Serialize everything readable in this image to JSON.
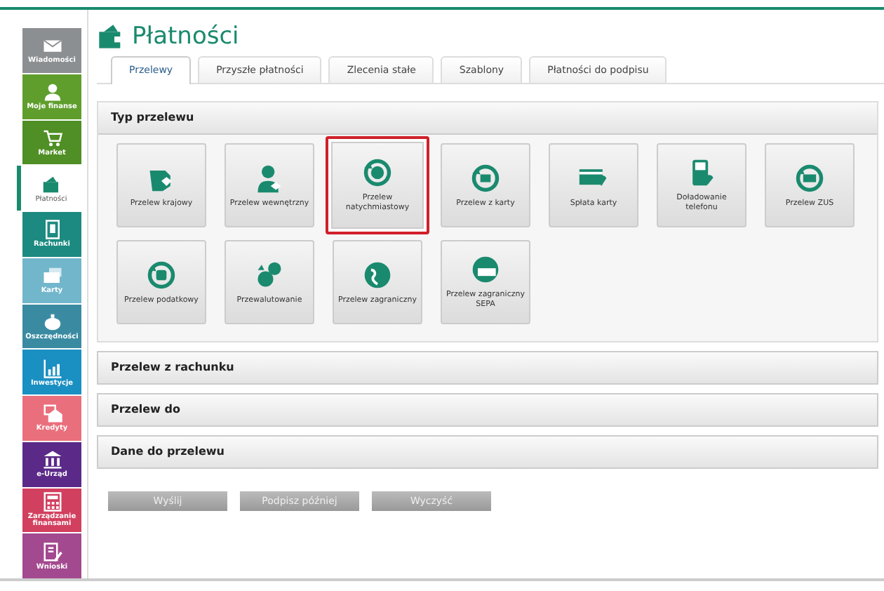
{
  "sidebar": {
    "items": [
      {
        "label": "Wiadomości",
        "selected": false,
        "color": "#8c8f92"
      },
      {
        "label": "Moje finanse",
        "selected": false,
        "color": "#5f9e2c"
      },
      {
        "label": "Market",
        "selected": false,
        "color": "#4f8f25"
      },
      {
        "label": "Płatności",
        "selected": true,
        "color": "#1a8a6e"
      },
      {
        "label": "Rachunki",
        "selected": false,
        "color": "#1c8a80"
      },
      {
        "label": "Karty",
        "selected": false,
        "color": "#72b6cc"
      },
      {
        "label": "Oszczędności",
        "selected": false,
        "color": "#3a8ba2"
      },
      {
        "label": "Inwestycje",
        "selected": false,
        "color": "#1a8fc2"
      },
      {
        "label": "Kredyty",
        "selected": false,
        "color": "#ea6f7c"
      },
      {
        "label": "e-Urząd",
        "selected": false,
        "color": "#5b2a88"
      },
      {
        "label": "Zarządzanie finansami",
        "selected": false,
        "color": "#d2405f"
      },
      {
        "label": "Wnioski",
        "selected": false,
        "color": "#a3498f"
      }
    ]
  },
  "page_title": "Płatności",
  "tabs": [
    {
      "label": "Przelewy",
      "selected": true
    },
    {
      "label": "Przyszłe płatności",
      "selected": false
    },
    {
      "label": "Zlecenia stałe",
      "selected": false
    },
    {
      "label": "Szablony",
      "selected": false
    },
    {
      "label": "Płatności do podpisu",
      "selected": false
    }
  ],
  "transfer_type": {
    "title": "Typ przelewu",
    "tiles": [
      {
        "label": "Przelew krajowy",
        "selected": false
      },
      {
        "label": "Przelew wewnętrzny",
        "selected": false
      },
      {
        "label": "Przelew natychmiastowy",
        "selected": true
      },
      {
        "label": "Przelew z karty",
        "selected": false
      },
      {
        "label": "Spłata karty",
        "selected": false
      },
      {
        "label": "Doładowanie telefonu",
        "selected": false
      },
      {
        "label": "Przelew ZUS",
        "selected": false
      },
      {
        "label": "Przelew podatkowy",
        "selected": false
      },
      {
        "label": "Przewalutowanie",
        "selected": false
      },
      {
        "label": "Przelew zagraniczny",
        "selected": false
      },
      {
        "label": "Przelew zagraniczny SEPA",
        "selected": false
      }
    ]
  },
  "sections": [
    "Przelew z rachunku",
    "Przelew do",
    "Dane do przelewu"
  ],
  "buttons": [
    "Wyślij",
    "Podpisz później",
    "Wyczyść"
  ]
}
